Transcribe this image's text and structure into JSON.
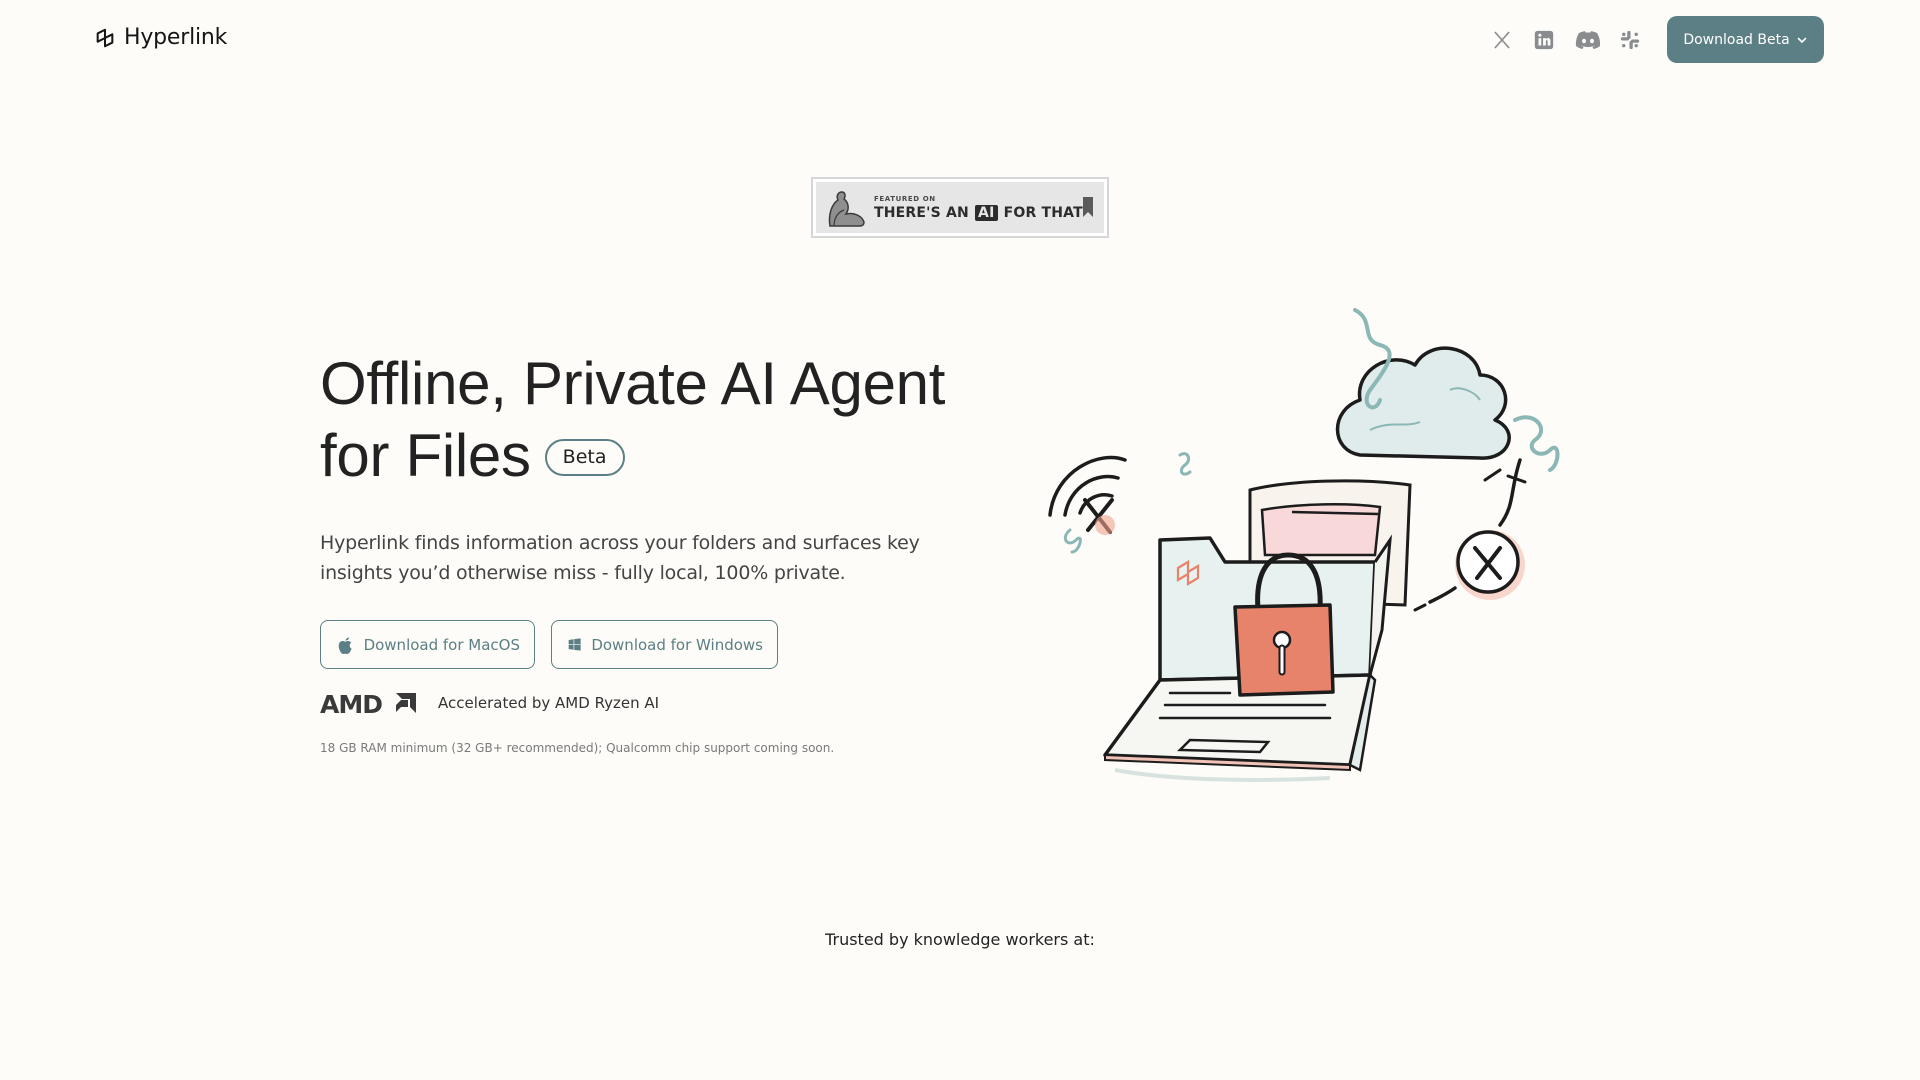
{
  "header": {
    "brand": "Hyperlink",
    "social_icons": [
      "x-icon",
      "linkedin-icon",
      "discord-icon",
      "slack-icon"
    ],
    "download_beta_label": "Download Beta"
  },
  "badge": {
    "featured_on": "FEATURED ON",
    "text_before": "THERE'S AN",
    "text_ai": "AI",
    "text_after": "FOR THAT"
  },
  "hero": {
    "title_line1": "Offline, Private AI Agent",
    "title_line2": "for Files",
    "beta_label": "Beta",
    "subtitle": "Hyperlink finds information across your folders and surfaces key insights you’d otherwise miss - fully local, 100% private.",
    "mac_button": "Download for MacOS",
    "windows_button": "Download for Windows",
    "amd_logo": "AMD",
    "amd_text": "Accelerated by AMD Ryzen AI",
    "requirements": "18 GB RAM minimum (32 GB+ recommended); Qualcomm chip support coming soon."
  },
  "trusted": {
    "label": "Trusted by knowledge workers at:"
  },
  "colors": {
    "accent": "#5b7f84",
    "background": "#fdfcf8",
    "lock": "#e8836b"
  }
}
